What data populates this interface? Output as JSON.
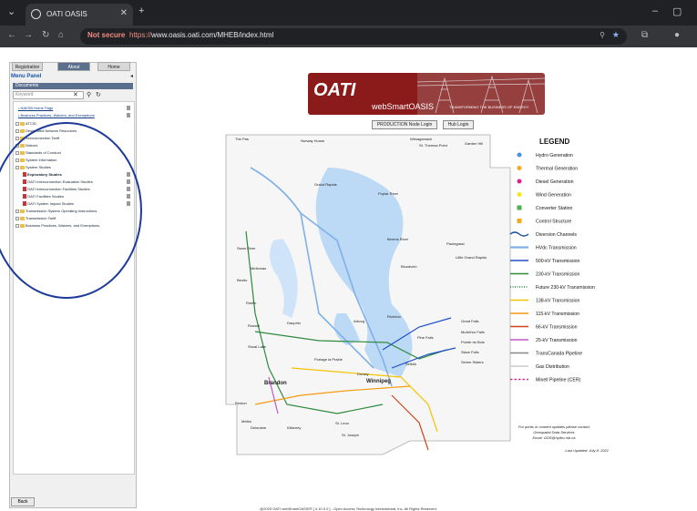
{
  "browser": {
    "tab_title": "OATI OASIS",
    "not_secure": "Not secure",
    "url_https": "https://",
    "url_rest": "www.oasis.oati.com/MHEB/index.html"
  },
  "portal": {
    "tabs": [
      "Registration",
      "About",
      "Home"
    ],
    "menu_title": "Menu Panel",
    "sub_title": "Documents",
    "keyword_placeholder": "Keyword",
    "tree": [
      "NAESB Home Page",
      "Business Practices, Waivers, and Exemptions",
      "ATCID",
      "Designated Network Resources",
      "Interconnection Tariff",
      "Notices",
      "Standards of Conduct",
      "System Information",
      "System Studies",
      "Exploratory Studies",
      "OATI Interconnection Evaluation Studies",
      "OATI Interconnection Facilities Studies",
      "OATI Facilities Studies",
      "OATI System Impact Studies",
      "Transmission System Operating Instructions",
      "Transmission Tariff",
      "Business Practices, Waivers, and Exemptions"
    ],
    "back_label": "Back"
  },
  "banner": {
    "logo": "OATI",
    "product": "webSmartOASIS",
    "tagline": "TRANSFORMING THE BUSINESS OF ENERGY"
  },
  "login": {
    "production": "PRODUCTION Node Login",
    "hub": "Hub Login"
  },
  "map": {
    "legend_title": "LEGEND",
    "legend": [
      {
        "label": "Hydro Generation",
        "color": "#4a90e2",
        "kind": "dot"
      },
      {
        "label": "Thermal Generation",
        "color": "#f5a623",
        "kind": "dot"
      },
      {
        "label": "Diesel Generation",
        "color": "#e0208a",
        "kind": "dot"
      },
      {
        "label": "Wind Generation",
        "color": "#f8e71c",
        "kind": "dot"
      },
      {
        "label": "Converter Station",
        "color": "#4caf50",
        "kind": "sq"
      },
      {
        "label": "Control Structure",
        "color": "#f5a623",
        "kind": "sq"
      },
      {
        "label": "Diversion Channels",
        "color": "#1e50a0",
        "kind": "wave"
      },
      {
        "label": "HVdc Transmission",
        "color": "#7fb0e6",
        "kind": "dbl"
      },
      {
        "label": "500-kV Transmission",
        "color": "#1e50c8",
        "kind": "line"
      },
      {
        "label": "230-kV Transmission",
        "color": "#2e8b3e",
        "kind": "line"
      },
      {
        "label": "Future 230-kV Transmission",
        "color": "#2e8b3e",
        "kind": "dot-line"
      },
      {
        "label": "138-kV Transmission",
        "color": "#f5c400",
        "kind": "line"
      },
      {
        "label": "115-kV Transmission",
        "color": "#f39c12",
        "kind": "line"
      },
      {
        "label": "66-kV Transmission",
        "color": "#d0451b",
        "kind": "line"
      },
      {
        "label": "25-kV Transmission",
        "color": "#c05ac8",
        "kind": "line"
      },
      {
        "label": "TransCanada Pipeline",
        "color": "#888888",
        "kind": "line"
      },
      {
        "label": "Gas Distribution",
        "color": "#cccccc",
        "kind": "line"
      },
      {
        "label": "Minell Pipeline (CER)",
        "color": "#d0308a",
        "kind": "dash"
      }
    ],
    "note1": "For prints or content updates please contact",
    "note2": "Geospatial Data Services",
    "note3": "Email: GDS@hydro.mb.ca",
    "updated": "Last Updated: July 8, 2021",
    "places": [
      "The Pas",
      "Norway House",
      "Wesagamack",
      "St. Theresa Point",
      "Garden Hill",
      "Grand Rapids",
      "Poplar River",
      "Berens River",
      "Pauingassi",
      "Little Grand Rapids",
      "Bloodvein",
      "Swan River",
      "Minitonas",
      "Benito",
      "Roblin",
      "Dauphin",
      "Russell",
      "Shoal Lake",
      "Arborg",
      "Riverton",
      "Great Falls",
      "McArthur Falls",
      "Pine Falls",
      "Pointe du Bois",
      "Slave Falls",
      "Seven Sisters",
      "Portage la Prairie",
      "Selkirk",
      "Dorsey",
      "Winnipeg",
      "Brandon",
      "Reston",
      "Melita",
      "Deloraine",
      "Killarney",
      "St. Leon",
      "St. Joseph"
    ]
  },
  "footer": "@2025 OATI webSmartOASIS® [ 4.10.0.0 ] - Open Access Technology International, Inc. All Rights Reserved."
}
